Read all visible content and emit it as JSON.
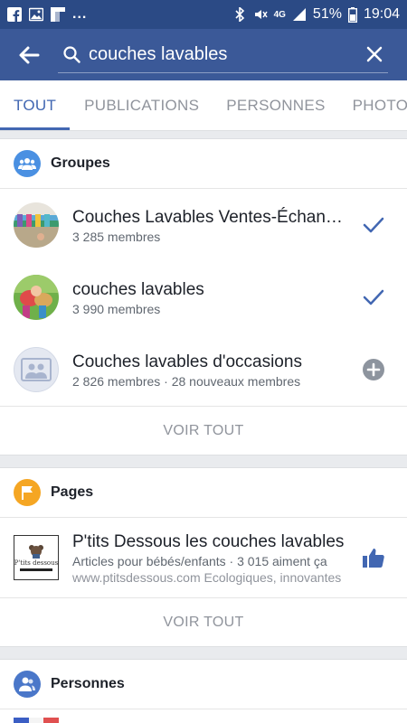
{
  "status_bar": {
    "dots": "...",
    "network": "4G",
    "battery": "51%",
    "time": "19:04"
  },
  "search": {
    "query": "couches lavables"
  },
  "tabs": [
    {
      "label": "TOUT",
      "active": true
    },
    {
      "label": "PUBLICATIONS",
      "active": false
    },
    {
      "label": "PERSONNES",
      "active": false
    },
    {
      "label": "PHOTOS",
      "active": false
    }
  ],
  "groups": {
    "title": "Groupes",
    "icon": "groups-icon",
    "items": [
      {
        "name": "Couches Lavables Ventes-Échanges",
        "meta": "3 285 membres",
        "action": "joined-check-icon"
      },
      {
        "name": "couches lavables",
        "meta": "3 990 membres",
        "action": "joined-check-icon"
      },
      {
        "name": "Couches lavables d'occasions",
        "meta": "2 826 membres · 28 nouveaux membres",
        "action": "join-plus-icon"
      }
    ],
    "see_all": "VOIR TOUT"
  },
  "pages": {
    "title": "Pages",
    "icon": "flag-icon",
    "items": [
      {
        "name": "P'tits Dessous les couches lavables",
        "meta": "Articles pour bébés/enfants · 3 015 aiment ça",
        "description": "www.ptitsdessous.com Ecologiques, innovantes",
        "thumb_text": "P'tits dessous",
        "action": "like-thumb-icon"
      }
    ],
    "see_all": "VOIR TOUT"
  },
  "people": {
    "title": "Personnes",
    "icon": "person-icon"
  },
  "colors": {
    "header": "#3b5998",
    "status_bar": "#2b4a85",
    "accent": "#4267b2",
    "groups_icon": "#4a90e2",
    "pages_icon": "#f5a623",
    "people_icon": "#4a77c9"
  }
}
